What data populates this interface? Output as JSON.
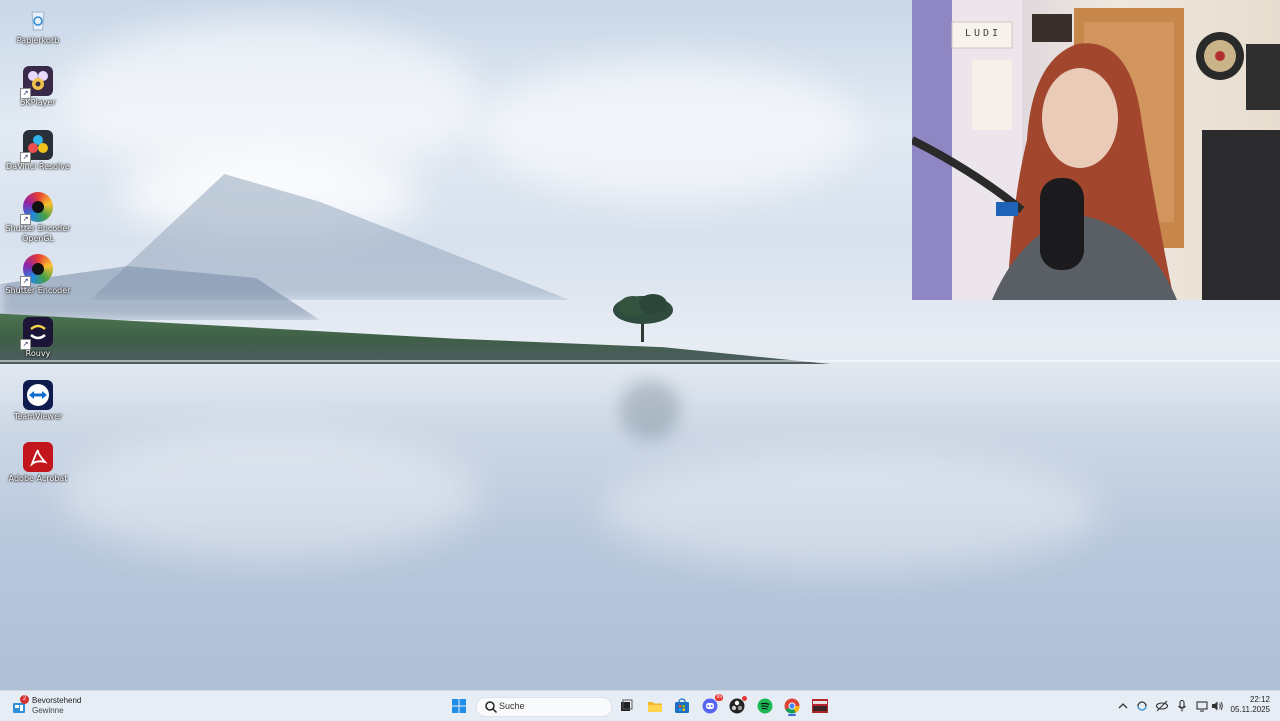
{
  "desktop_icons": [
    {
      "label": "Papierkorb",
      "icon": "recycle-bin-icon"
    },
    {
      "label": "5KPlayer",
      "icon": "5kplayer-icon"
    },
    {
      "label": "DaVinci Resolve",
      "icon": "davinci-resolve-icon"
    },
    {
      "label": "Shutter Encoder OpenGL",
      "icon": "shutter-encoder-opengl-icon"
    },
    {
      "label": "Shutter Encoder",
      "icon": "shutter-encoder-icon"
    },
    {
      "label": "Rouvy",
      "icon": "rouvy-icon"
    },
    {
      "label": "TeamViewer",
      "icon": "teamviewer-icon"
    },
    {
      "label": "Adobe Acrobat",
      "icon": "adobe-acrobat-icon"
    }
  ],
  "webcam": {
    "sign_text": "LUDI"
  },
  "taskbar": {
    "widget": {
      "line1": "Bevorstehend",
      "line2": "Gewinne",
      "badge": "2"
    },
    "search_placeholder": "Suche",
    "apps": [
      "start-icon",
      "search",
      "task-view-icon",
      "file-explorer-icon",
      "microsoft-store-icon",
      "discord-icon",
      "obs-icon",
      "spotify-icon",
      "chrome-icon",
      "voicemeeter-icon"
    ],
    "discord_badge": "99",
    "clock": {
      "time": "22:12",
      "date": "05.11.2025"
    }
  }
}
